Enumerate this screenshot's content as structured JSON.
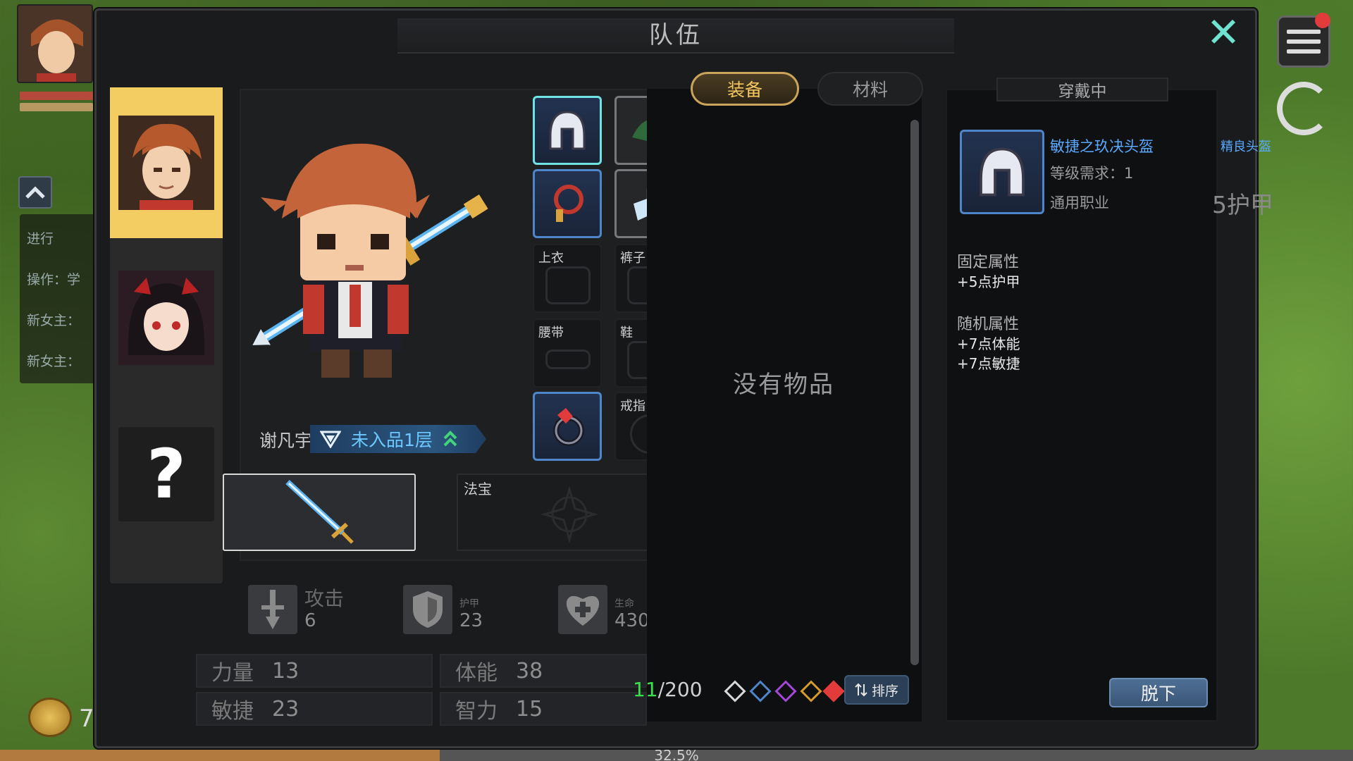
{
  "modal": {
    "title": "队伍"
  },
  "hud": {
    "coin_value": "7",
    "log_items": [
      "进行",
      "操作：学",
      "新女主：",
      "新女主："
    ],
    "progress_text": "32.5%",
    "progress_fraction": 0.325
  },
  "characters": [
    {
      "name": "谢凡宇",
      "avatar": "hero-avatar",
      "active": true
    },
    {
      "name": "",
      "avatar": "heroine-avatar",
      "active": false
    },
    {
      "name": "",
      "avatar": "question-mark-icon",
      "symbol": "?",
      "active": false
    }
  ],
  "hero": {
    "name": "谢凡宇",
    "realm": "未入品1层"
  },
  "equip_slots": {
    "shirt": "上衣",
    "pants": "裤子",
    "belt": "腰带",
    "shoes": "鞋",
    "ring": "戒指",
    "fabao": "法宝"
  },
  "stats": {
    "attack": {
      "label": "攻击",
      "value": "6"
    },
    "armor": {
      "label": "护甲",
      "value": "23"
    },
    "hp": {
      "label": "生命",
      "value": "430"
    }
  },
  "attributes": [
    {
      "label": "力量",
      "value": "13"
    },
    {
      "label": "体能",
      "value": "38"
    },
    {
      "label": "敏捷",
      "value": "23"
    },
    {
      "label": "智力",
      "value": "15"
    }
  ],
  "inventory": {
    "tabs": [
      "装备",
      "材料"
    ],
    "empty_text": "没有物品",
    "count_used": "11",
    "count_total": "/200",
    "sort_label": "排序",
    "filter_colors": [
      "#d8d8d8",
      "#4f86c9",
      "#a347d6",
      "#d69b2c",
      "#e23b3b"
    ]
  },
  "wearing": {
    "tab": "穿戴中",
    "item_name": "敏捷之玖决头盔",
    "item_type": "精良头盔",
    "requirement": "等级需求：1",
    "job": "通用职业",
    "armor": "5护甲",
    "fixed_title": "固定属性",
    "fixed_lines": [
      "+5点护甲"
    ],
    "random_title": "随机属性",
    "random_lines": [
      "+7点体能",
      "+7点敏捷"
    ],
    "unequip_label": "脱下"
  },
  "colors": {
    "accent_gold": "#f2c75f",
    "rare_blue": "#5aa8ff",
    "close_cyan": "#6fe3cf",
    "count_green": "#39e04c"
  }
}
